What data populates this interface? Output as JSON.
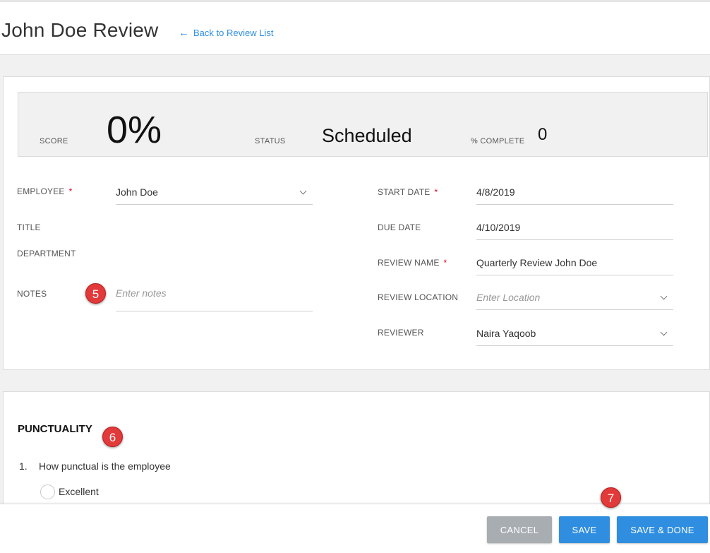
{
  "header": {
    "title": "John Doe Review",
    "back_link": "Back to Review List",
    "back_arrow": "←"
  },
  "stats": {
    "score_label": "SCORE",
    "score_value": "0%",
    "status_label": "STATUS",
    "status_value": "Scheduled",
    "complete_label": "% COMPLETE",
    "complete_value": "0"
  },
  "form": {
    "employee_label": "EMPLOYEE",
    "employee_value": "John Doe",
    "title_label": "TITLE",
    "department_label": "DEPARTMENT",
    "notes_label": "NOTES",
    "notes_placeholder": "Enter notes",
    "start_date_label": "START DATE",
    "start_date_value": "4/8/2019",
    "due_date_label": "DUE DATE",
    "due_date_value": "4/10/2019",
    "review_name_label": "REVIEW NAME",
    "review_name_value": "Quarterly Review John Doe",
    "review_location_label": "REVIEW LOCATION",
    "review_location_placeholder": "Enter Location",
    "reviewer_label": "REVIEWER",
    "reviewer_value": "Naira Yaqoob",
    "required_marker": "*"
  },
  "section": {
    "title": "PUNCTUALITY",
    "question_number": "1.",
    "question_text": "How punctual is the employee",
    "option_1": "Excellent"
  },
  "callouts": {
    "notes_badge": "5",
    "section_badge": "6",
    "save_badge": "7"
  },
  "footer": {
    "cancel_label": "CANCEL",
    "save_label": "SAVE",
    "save_done_label": "SAVE & DONE"
  },
  "colors": {
    "accent": "#2f8ee0",
    "cancel": "#a8adb2",
    "required": "#d9001b",
    "callout": "#e23a3a"
  }
}
